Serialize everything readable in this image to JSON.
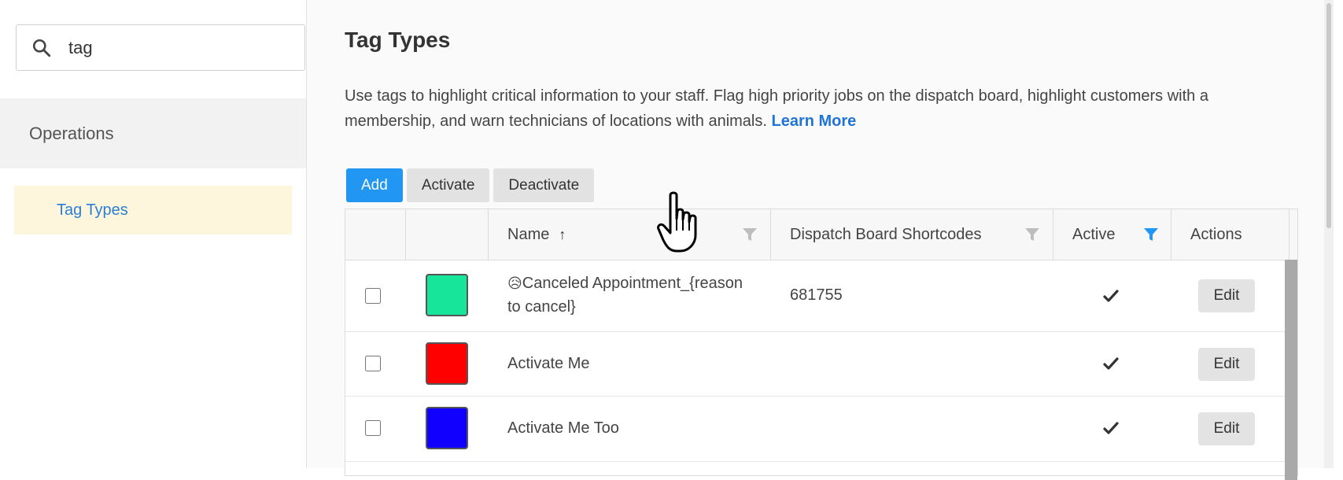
{
  "sidebar": {
    "search": {
      "value": "tag",
      "icon": "search-icon"
    },
    "section_label": "Operations",
    "nav_items": [
      {
        "label": "Tag Types"
      }
    ]
  },
  "main": {
    "title": "Tag Types",
    "description": "Use tags to highlight critical information to your staff. Flag high priority jobs on the dispatch board, highlight customers with a membership, and warn technicians of locations with animals.",
    "learn_more": "Learn More",
    "buttons": {
      "add": "Add",
      "activate": "Activate",
      "deactivate": "Deactivate"
    },
    "table": {
      "headers": {
        "name": "Name",
        "sort_indicator": "↑",
        "shortcodes": "Dispatch Board Shortcodes",
        "active": "Active",
        "actions": "Actions"
      },
      "rows": [
        {
          "emoji": "😥",
          "name": "Canceled Appointment_{reason to cancel}",
          "color": "#16e59a",
          "shortcode": "681755",
          "active": true,
          "edit": "Edit"
        },
        {
          "emoji": "",
          "name": "Activate Me",
          "color": "#ff0000",
          "shortcode": "",
          "active": true,
          "edit": "Edit"
        },
        {
          "emoji": "",
          "name": "Activate Me Too",
          "color": "#1200ff",
          "shortcode": "",
          "active": true,
          "edit": "Edit"
        }
      ]
    }
  },
  "colors": {
    "primary": "#2196f3",
    "link": "#1f74d6",
    "nav_active_bg": "#fdf6dd",
    "filter_active": "#2196f3",
    "filter_inactive": "#bdbdbd"
  }
}
